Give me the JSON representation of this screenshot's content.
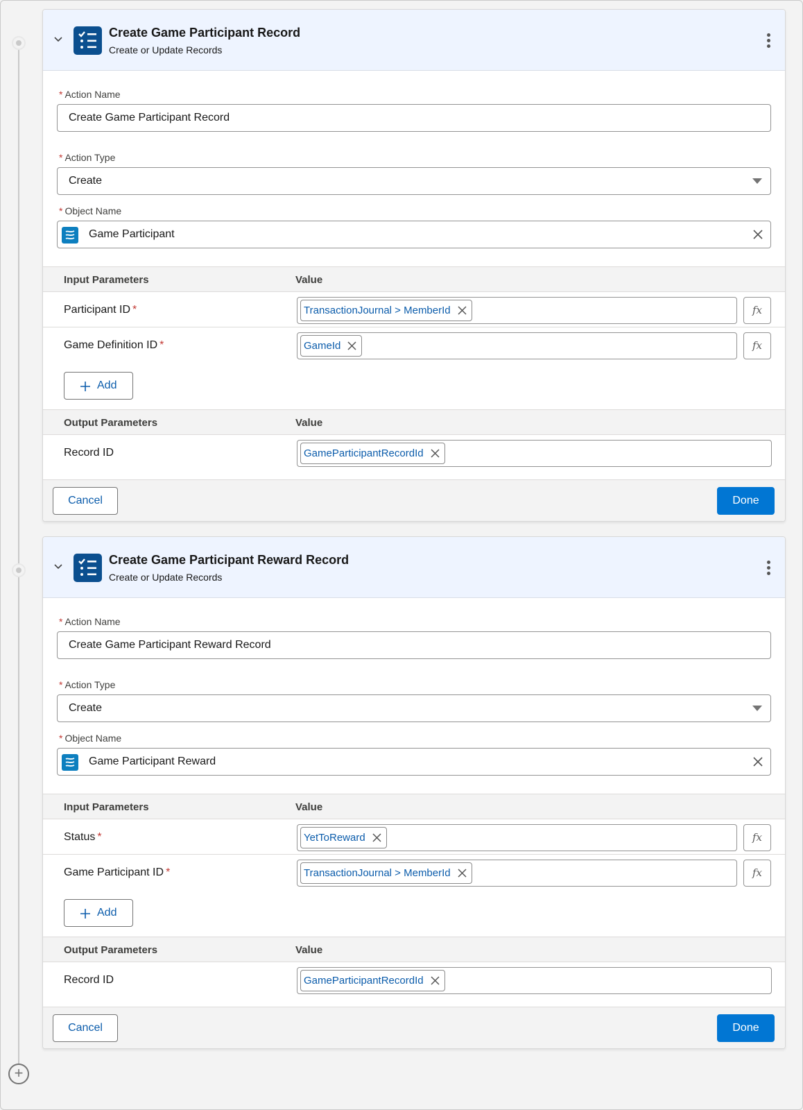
{
  "cards": [
    {
      "title": "Create Game Participant Record",
      "subtitle": "Create or Update Records",
      "action_name_label": "Action Name",
      "action_name_value": "Create Game Participant Record",
      "action_type_label": "Action Type",
      "action_type_value": "Create",
      "object_name_label": "Object Name",
      "object_name_value": "Game Participant",
      "input_header": "Input Parameters",
      "value_header": "Value",
      "inputs": [
        {
          "label": "Participant ID",
          "value": "TransactionJournal > MemberId"
        },
        {
          "label": "Game Definition ID",
          "value": "GameId"
        }
      ],
      "add_label": "Add",
      "output_header": "Output Parameters",
      "output_value_header": "Value",
      "outputs": [
        {
          "label": "Record ID",
          "value": "GameParticipantRecordId"
        }
      ],
      "cancel_label": "Cancel",
      "done_label": "Done"
    },
    {
      "title": "Create Game Participant Reward Record",
      "subtitle": "Create or Update Records",
      "action_name_label": "Action Name",
      "action_name_value": "Create Game Participant Reward Record",
      "action_type_label": "Action Type",
      "action_type_value": "Create",
      "object_name_label": "Object Name",
      "object_name_value": "Game Participant Reward",
      "input_header": "Input Parameters",
      "value_header": "Value",
      "inputs": [
        {
          "label": "Status",
          "value": "YetToReward"
        },
        {
          "label": "Game Participant ID",
          "value": "TransactionJournal > MemberId"
        }
      ],
      "add_label": "Add",
      "output_header": "Output Parameters",
      "output_value_header": "Value",
      "outputs": [
        {
          "label": "Record ID",
          "value": "GameParticipantRecordId"
        }
      ],
      "cancel_label": "Cancel",
      "done_label": "Done"
    }
  ],
  "icons": {
    "header": "checklist-icon",
    "object": "game-object-icon",
    "collapse": "chevron-down-icon",
    "menu": "kebab-menu-icon",
    "clear": "close-icon",
    "formula": "fx-formula-icon",
    "add_element": "add-circle-icon"
  },
  "colors": {
    "header_bg": "#eef4ff",
    "header_icon": "#0b4f8f",
    "object_icon": "#0d7fbf",
    "brand_button": "#0176d3",
    "link": "#0b5cab",
    "required": "#c23934"
  }
}
